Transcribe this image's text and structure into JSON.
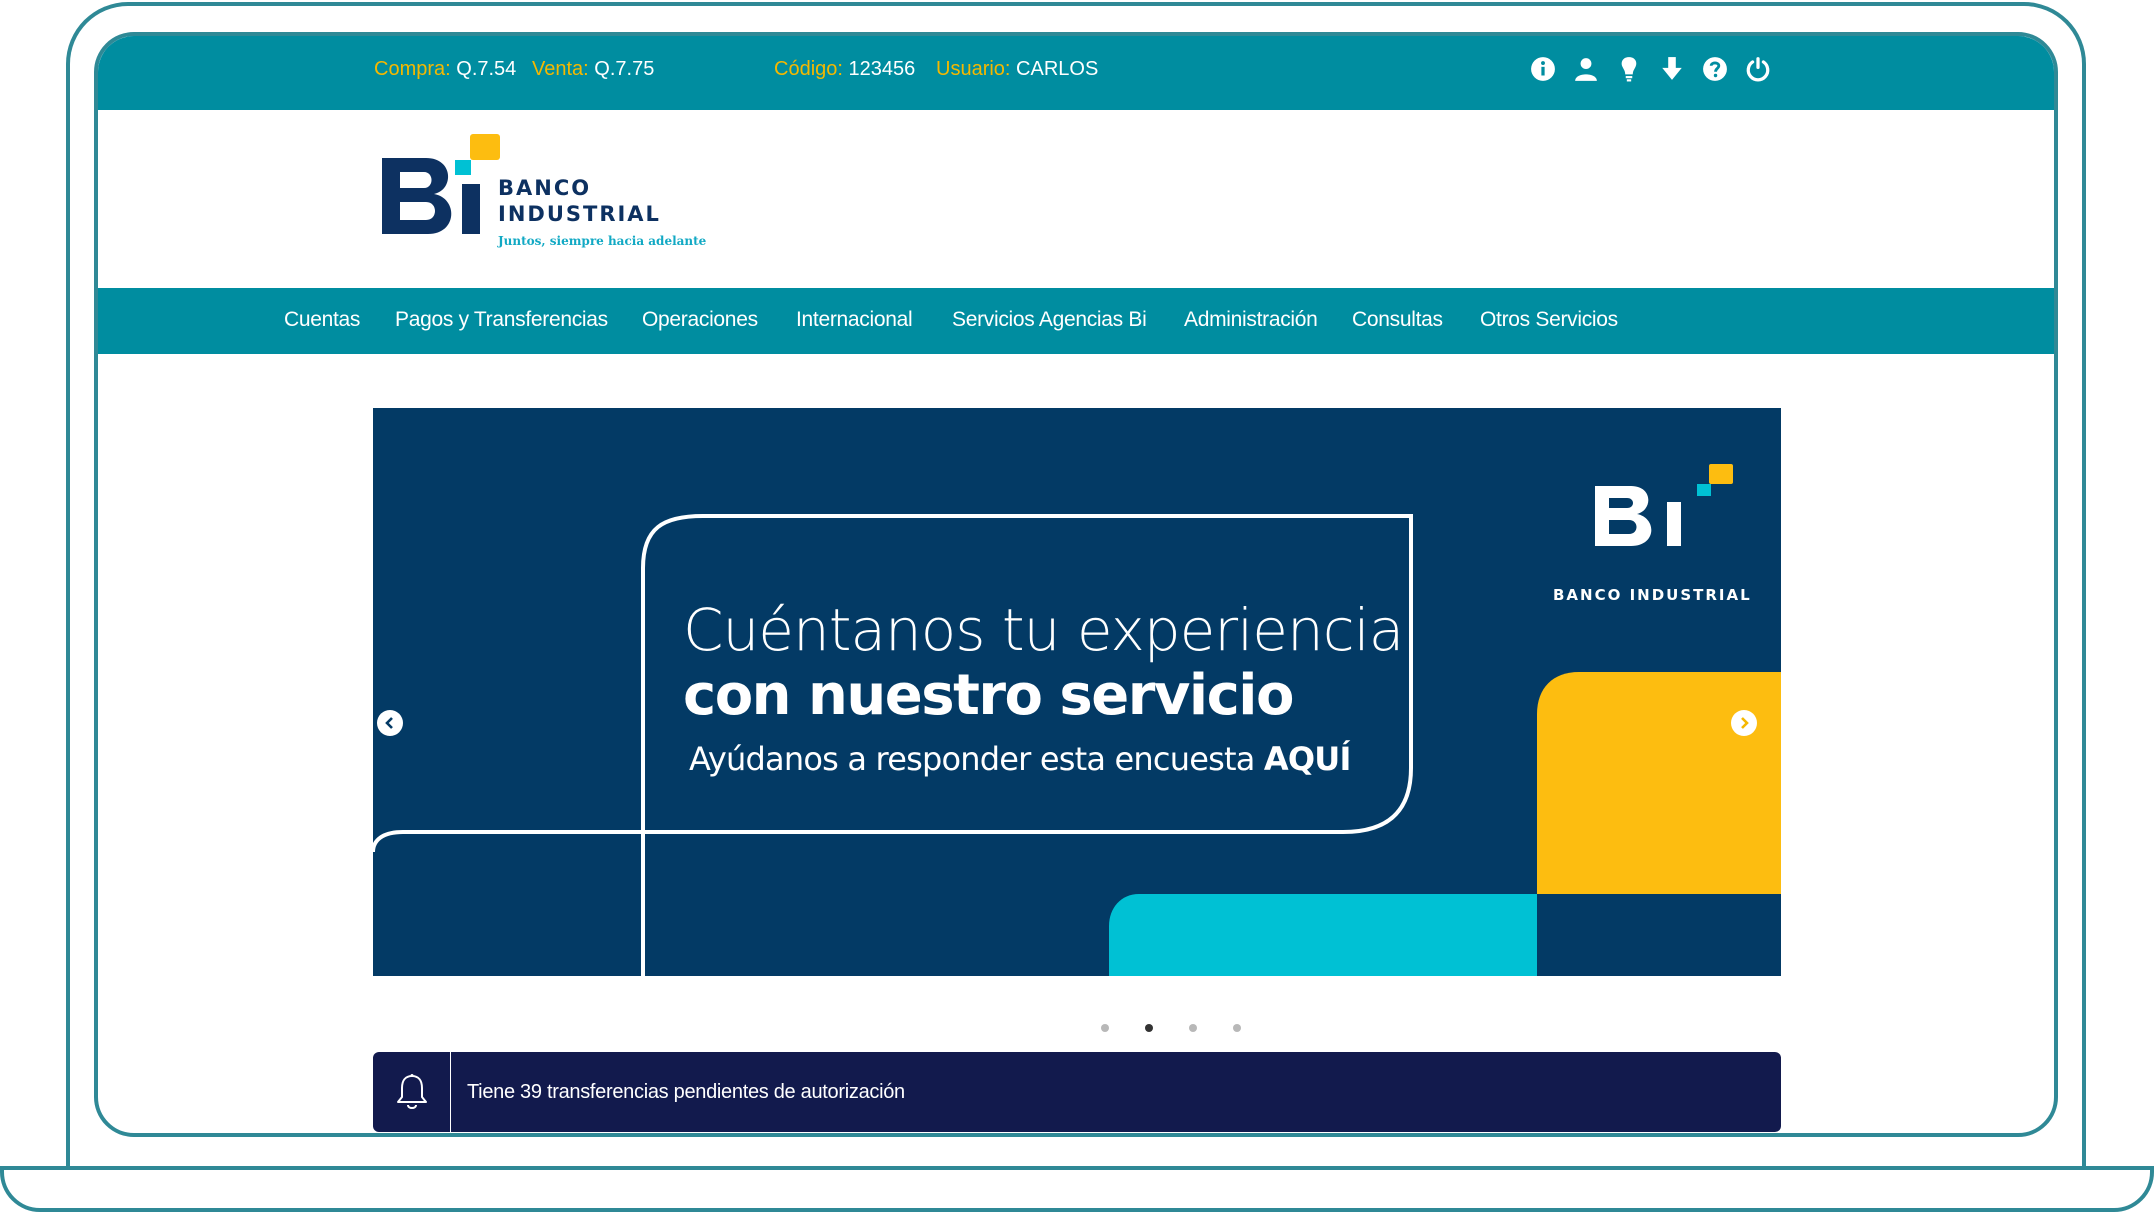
{
  "topbar": {
    "compra_label": "Compra:",
    "compra_value": "Q.7.54",
    "venta_label": "Venta:",
    "venta_value": "Q.7.75",
    "codigo_label": "Código:",
    "codigo_value": "123456",
    "usuario_label": "Usuario:",
    "usuario_value": "CARLOS",
    "icons": [
      "info-icon",
      "user-icon",
      "lightbulb-icon",
      "download-icon",
      "help-icon",
      "power-icon"
    ]
  },
  "logo": {
    "bank": "BANCO",
    "industrial": "INDUSTRIAL",
    "tagline": "Juntos, siempre hacia adelante"
  },
  "nav": {
    "items": [
      "Cuentas",
      "Pagos y Transferencias",
      "Operaciones",
      "Internacional",
      "Servicios Agencias Bi",
      "Administración",
      "Consultas",
      "Otros Servicios"
    ]
  },
  "banner": {
    "line1": "Cuéntanos tu experiencia",
    "line2": "con nuestro servicio",
    "line3": "Ayúdanos a responder esta encuesta",
    "line3_bold": "AQUÍ",
    "brand": "BANCO INDUSTRIAL"
  },
  "carousel": {
    "slide_count": 4,
    "active_index": 1
  },
  "notification": {
    "text": "Tiene 39 transferencias pendientes de autorización"
  },
  "colors": {
    "teal": "#008da0",
    "gold": "#f5b800",
    "navy": "#033a65",
    "dark_navy": "#121a4d",
    "cyan": "#00c1d4",
    "yellow": "#fdbd10"
  }
}
